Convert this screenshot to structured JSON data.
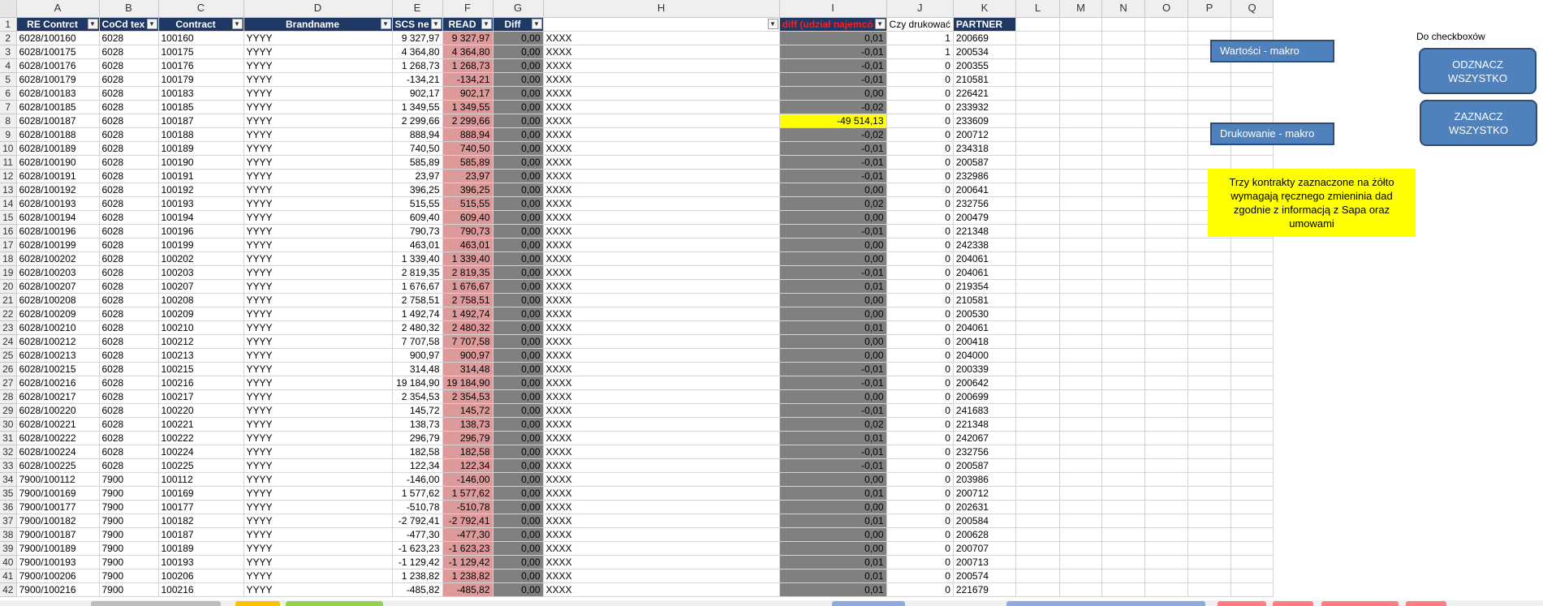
{
  "column_headers": [
    "A",
    "B",
    "C",
    "D",
    "E",
    "F",
    "G",
    "H",
    "I",
    "J",
    "K",
    "L",
    "M",
    "N",
    "O",
    "P",
    "Q"
  ],
  "header_row": {
    "row_number": "1",
    "cells": [
      "RE Contrct",
      "CoCd tex",
      "Contract",
      "Brandname",
      "SCS ne",
      "READ",
      "Diff",
      "",
      "diff (udział najemcó",
      "Czy drukować",
      "PARTNER"
    ]
  },
  "rows": [
    [
      "2",
      "6028/100160",
      "6028",
      "100160",
      "YYYY",
      "9 327,97",
      "9 327,97",
      "0,00",
      "XXXX",
      "0,01",
      "1",
      "200669"
    ],
    [
      "3",
      "6028/100175",
      "6028",
      "100175",
      "YYYY",
      "4 364,80",
      "4 364,80",
      "0,00",
      "XXXX",
      "-0,01",
      "1",
      "200534"
    ],
    [
      "4",
      "6028/100176",
      "6028",
      "100176",
      "YYYY",
      "1 268,73",
      "1 268,73",
      "0,00",
      "XXXX",
      "-0,01",
      "0",
      "200355"
    ],
    [
      "5",
      "6028/100179",
      "6028",
      "100179",
      "YYYY",
      "-134,21",
      "-134,21",
      "0,00",
      "XXXX",
      "-0,01",
      "0",
      "210581"
    ],
    [
      "6",
      "6028/100183",
      "6028",
      "100183",
      "YYYY",
      "902,17",
      "902,17",
      "0,00",
      "XXXX",
      "0,00",
      "0",
      "226421"
    ],
    [
      "7",
      "6028/100185",
      "6028",
      "100185",
      "YYYY",
      "1 349,55",
      "1 349,55",
      "0,00",
      "XXXX",
      "-0,02",
      "0",
      "233932"
    ],
    [
      "8",
      "6028/100187",
      "6028",
      "100187",
      "YYYY",
      "2 299,66",
      "2 299,66",
      "0,00",
      "XXXX",
      "-49 514,13",
      "0",
      "233609"
    ],
    [
      "9",
      "6028/100188",
      "6028",
      "100188",
      "YYYY",
      "888,94",
      "888,94",
      "0,00",
      "XXXX",
      "-0,02",
      "0",
      "200712"
    ],
    [
      "10",
      "6028/100189",
      "6028",
      "100189",
      "YYYY",
      "740,50",
      "740,50",
      "0,00",
      "XXXX",
      "-0,01",
      "0",
      "234318"
    ],
    [
      "11",
      "6028/100190",
      "6028",
      "100190",
      "YYYY",
      "585,89",
      "585,89",
      "0,00",
      "XXXX",
      "-0,01",
      "0",
      "200587"
    ],
    [
      "12",
      "6028/100191",
      "6028",
      "100191",
      "YYYY",
      "23,97",
      "23,97",
      "0,00",
      "XXXX",
      "-0,01",
      "0",
      "232986"
    ],
    [
      "13",
      "6028/100192",
      "6028",
      "100192",
      "YYYY",
      "396,25",
      "396,25",
      "0,00",
      "XXXX",
      "0,00",
      "0",
      "200641"
    ],
    [
      "14",
      "6028/100193",
      "6028",
      "100193",
      "YYYY",
      "515,55",
      "515,55",
      "0,00",
      "XXXX",
      "0,02",
      "0",
      "232756"
    ],
    [
      "15",
      "6028/100194",
      "6028",
      "100194",
      "YYYY",
      "609,40",
      "609,40",
      "0,00",
      "XXXX",
      "0,00",
      "0",
      "200479"
    ],
    [
      "16",
      "6028/100196",
      "6028",
      "100196",
      "YYYY",
      "790,73",
      "790,73",
      "0,00",
      "XXXX",
      "-0,01",
      "0",
      "221348"
    ],
    [
      "17",
      "6028/100199",
      "6028",
      "100199",
      "YYYY",
      "463,01",
      "463,01",
      "0,00",
      "XXXX",
      "0,00",
      "0",
      "242338"
    ],
    [
      "18",
      "6028/100202",
      "6028",
      "100202",
      "YYYY",
      "1 339,40",
      "1 339,40",
      "0,00",
      "XXXX",
      "0,00",
      "0",
      "204061"
    ],
    [
      "19",
      "6028/100203",
      "6028",
      "100203",
      "YYYY",
      "2 819,35",
      "2 819,35",
      "0,00",
      "XXXX",
      "-0,01",
      "0",
      "204061"
    ],
    [
      "20",
      "6028/100207",
      "6028",
      "100207",
      "YYYY",
      "1 676,67",
      "1 676,67",
      "0,00",
      "XXXX",
      "0,01",
      "0",
      "219354"
    ],
    [
      "21",
      "6028/100208",
      "6028",
      "100208",
      "YYYY",
      "2 758,51",
      "2 758,51",
      "0,00",
      "XXXX",
      "0,00",
      "0",
      "210581"
    ],
    [
      "22",
      "6028/100209",
      "6028",
      "100209",
      "YYYY",
      "1 492,74",
      "1 492,74",
      "0,00",
      "XXXX",
      "0,00",
      "0",
      "200530"
    ],
    [
      "23",
      "6028/100210",
      "6028",
      "100210",
      "YYYY",
      "2 480,32",
      "2 480,32",
      "0,00",
      "XXXX",
      "0,01",
      "0",
      "204061"
    ],
    [
      "24",
      "6028/100212",
      "6028",
      "100212",
      "YYYY",
      "7 707,58",
      "7 707,58",
      "0,00",
      "XXXX",
      "0,00",
      "0",
      "200418"
    ],
    [
      "25",
      "6028/100213",
      "6028",
      "100213",
      "YYYY",
      "900,97",
      "900,97",
      "0,00",
      "XXXX",
      "0,00",
      "0",
      "204000"
    ],
    [
      "26",
      "6028/100215",
      "6028",
      "100215",
      "YYYY",
      "314,48",
      "314,48",
      "0,00",
      "XXXX",
      "-0,01",
      "0",
      "200339"
    ],
    [
      "27",
      "6028/100216",
      "6028",
      "100216",
      "YYYY",
      "19 184,90",
      "19 184,90",
      "0,00",
      "XXXX",
      "-0,01",
      "0",
      "200642"
    ],
    [
      "28",
      "6028/100217",
      "6028",
      "100217",
      "YYYY",
      "2 354,53",
      "2 354,53",
      "0,00",
      "XXXX",
      "0,00",
      "0",
      "200699"
    ],
    [
      "29",
      "6028/100220",
      "6028",
      "100220",
      "YYYY",
      "145,72",
      "145,72",
      "0,00",
      "XXXX",
      "-0,01",
      "0",
      "241683"
    ],
    [
      "30",
      "6028/100221",
      "6028",
      "100221",
      "YYYY",
      "138,73",
      "138,73",
      "0,00",
      "XXXX",
      "0,02",
      "0",
      "221348"
    ],
    [
      "31",
      "6028/100222",
      "6028",
      "100222",
      "YYYY",
      "296,79",
      "296,79",
      "0,00",
      "XXXX",
      "0,01",
      "0",
      "242067"
    ],
    [
      "32",
      "6028/100224",
      "6028",
      "100224",
      "YYYY",
      "182,58",
      "182,58",
      "0,00",
      "XXXX",
      "-0,01",
      "0",
      "232756"
    ],
    [
      "33",
      "6028/100225",
      "6028",
      "100225",
      "YYYY",
      "122,34",
      "122,34",
      "0,00",
      "XXXX",
      "-0,01",
      "0",
      "200587"
    ],
    [
      "34",
      "7900/100112",
      "7900",
      "100112",
      "YYYY",
      "-146,00",
      "-146,00",
      "0,00",
      "XXXX",
      "0,00",
      "0",
      "203986"
    ],
    [
      "35",
      "7900/100169",
      "7900",
      "100169",
      "YYYY",
      "1 577,62",
      "1 577,62",
      "0,00",
      "XXXX",
      "0,01",
      "0",
      "200712"
    ],
    [
      "36",
      "7900/100177",
      "7900",
      "100177",
      "YYYY",
      "-510,78",
      "-510,78",
      "0,00",
      "XXXX",
      "0,00",
      "0",
      "202631"
    ],
    [
      "37",
      "7900/100182",
      "7900",
      "100182",
      "YYYY",
      "-2 792,41",
      "-2 792,41",
      "0,00",
      "XXXX",
      "0,01",
      "0",
      "200584"
    ],
    [
      "38",
      "7900/100187",
      "7900",
      "100187",
      "YYYY",
      "-477,30",
      "-477,30",
      "0,00",
      "XXXX",
      "0,00",
      "0",
      "200628"
    ],
    [
      "39",
      "7900/100189",
      "7900",
      "100189",
      "YYYY",
      "-1 623,23",
      "-1 623,23",
      "0,00",
      "XXXX",
      "0,00",
      "0",
      "200707"
    ],
    [
      "40",
      "7900/100193",
      "7900",
      "100193",
      "YYYY",
      "-1 129,42",
      "-1 129,42",
      "0,00",
      "XXXX",
      "0,01",
      "0",
      "200713"
    ],
    [
      "41",
      "7900/100206",
      "7900",
      "100206",
      "YYYY",
      "1 238,82",
      "1 238,82",
      "0,00",
      "XXXX",
      "0,01",
      "0",
      "200574"
    ],
    [
      "42",
      "7900/100216",
      "7900",
      "100216",
      "YYYY",
      "-485,82",
      "-485,82",
      "0,00",
      "XXXX",
      "0,01",
      "0",
      "221679"
    ]
  ],
  "highlighted_row": "8",
  "controls": {
    "macro_values_button": "Wartości - makro",
    "macro_print_button": "Drukowanie - makro",
    "checkbox_label": "Do checkboxów",
    "uncheck_all_button": "ODZNACZ WSZYSTKO",
    "check_all_button": "ZAZNACZ WSZYSTKO",
    "note": "Trzy kontrakty zaznaczone na żółto wymagają ręcznego zmieninia dad zgodnie z informacją z Sapa oraz umowami"
  },
  "colors": {
    "header_bg": "#1f3864",
    "read_column_bg": "#dc9a9a",
    "diff_column_bg": "#808080",
    "highlight": "#ffff00",
    "button_bg": "#4f81bd"
  }
}
